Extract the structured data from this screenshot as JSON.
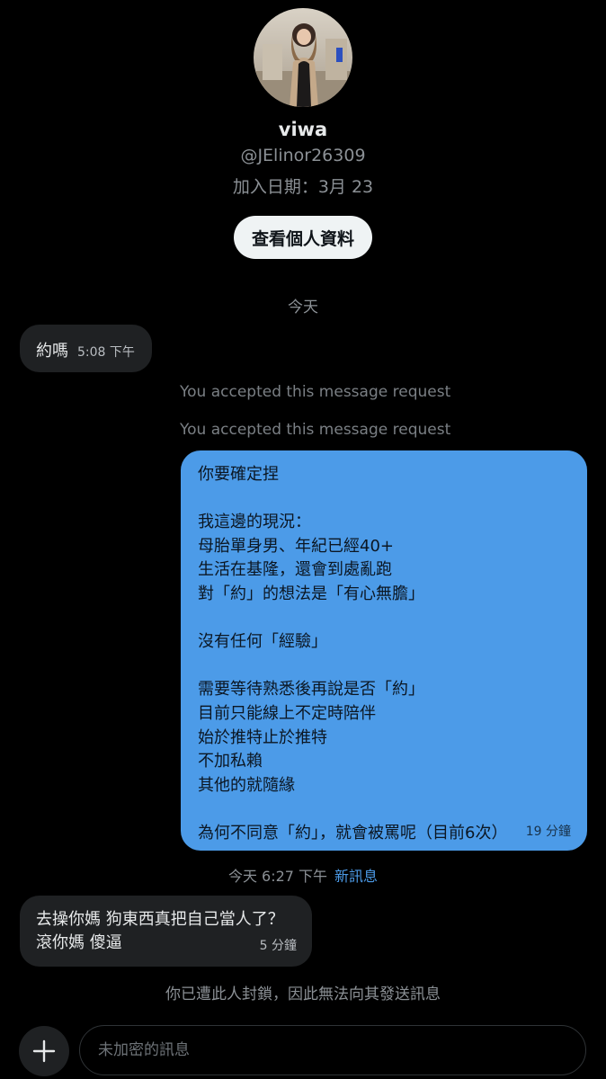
{
  "profile": {
    "display_name": "viwa",
    "handle": "@JElinor26309",
    "joined": "加入日期：3月 23",
    "view_profile_button": "查看個人資料"
  },
  "day_divider": "今天",
  "messages": {
    "first_incoming": {
      "text": "約嗎",
      "time": "5:08 下午"
    },
    "system_notices": [
      "You accepted this message request",
      "You accepted this message request"
    ],
    "outgoing": {
      "lines": [
        "你要確定捏",
        "",
        "我這邊的現況：",
        "母胎單身男、年紀已經40+",
        "生活在基隆，還會到處亂跑",
        "對「約」的想法是「有心無膽」",
        "",
        "沒有任何「經驗」",
        "",
        "需要等待熟悉後再說是否「約」",
        "目前只能線上不定時陪伴",
        "始於推特止於推特",
        "不加私賴",
        "其他的就隨緣",
        "",
        "為何不同意「約」，就會被罵呢（目前6次）"
      ],
      "time": "19 分鐘"
    },
    "new_divider": {
      "time": "今天 6:27 下午",
      "label": "新訊息"
    },
    "second_incoming": {
      "lines": [
        "去操你媽  狗東西真把自己當人了？",
        "滾你媽 傻逼"
      ],
      "time": "5 分鐘"
    }
  },
  "blocked_notice": "你已遭此人封鎖，因此無法向其發送訊息",
  "composer": {
    "placeholder": "未加密的訊息",
    "value": "",
    "add_icon": "plus-icon"
  },
  "colors": {
    "background": "#000000",
    "incoming_bubble": "#1f2123",
    "outgoing_bubble": "#4c9be8",
    "accent": "#4c9be8",
    "secondary_text": "#8b9095"
  }
}
